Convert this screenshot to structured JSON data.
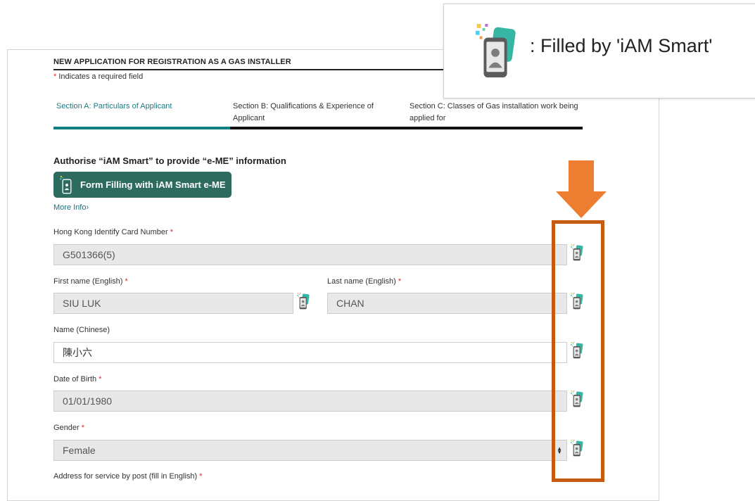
{
  "form": {
    "title": "NEW APPLICATION FOR REGISTRATION AS A GAS INSTALLER",
    "required_star": "*",
    "required_note": " Indicates a required field"
  },
  "tabs": [
    {
      "label": "Section A: Particulars of Applicant",
      "active": true
    },
    {
      "label": "Section B: Qualifications & Experience of Applicant",
      "active": false
    },
    {
      "label": "Section C: Classes of Gas installation work being applied for",
      "active": false
    }
  ],
  "iam_smart": {
    "heading": "Authorise “iAM Smart” to provide “e-ME” information",
    "button_label": "Form Filling with iAM Smart e-ME",
    "more_info": "More Info›",
    "legend_text": ": Filled by 'iAM Smart'",
    "icon": "iam-smart-phone-icon"
  },
  "fields": {
    "hkid": {
      "label": "Hong Kong Identify Card Number",
      "required": "*",
      "value": "G501366(5)"
    },
    "first_name": {
      "label": "First name (English)",
      "required": "*",
      "value": "SIU LUK"
    },
    "last_name": {
      "label": "Last name (English)",
      "required": "*",
      "value": "CHAN"
    },
    "name_chinese": {
      "label": "Name (Chinese)",
      "value": "陳小六"
    },
    "dob": {
      "label": "Date of Birth",
      "required": "*",
      "value": "01/01/1980"
    },
    "gender": {
      "label": "Gender",
      "required": "*",
      "value": "Female"
    },
    "address": {
      "label": "Address for service by post (fill in English)",
      "required": "*"
    }
  },
  "colors": {
    "accent_teal": "#137f84",
    "button_green": "#2c6b5e",
    "highlight_orange": "#c55a11",
    "arrow_orange": "#ed7d31",
    "required_red": "#e0262a"
  }
}
